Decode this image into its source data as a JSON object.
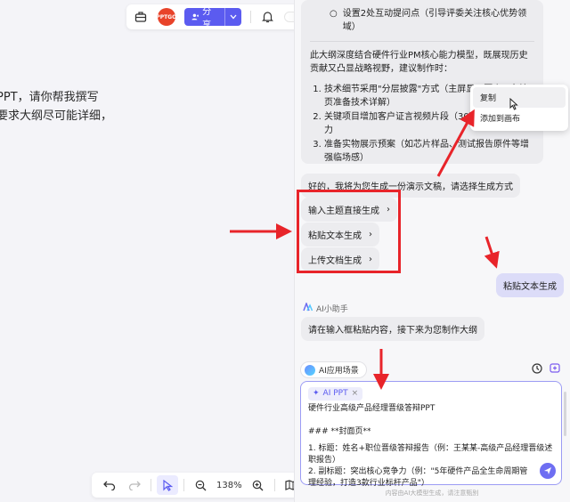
{
  "canvas": {
    "lines": [
      "PPT，请你帮我撰写",
      "要求大纲尽可能详细，"
    ]
  },
  "top_toolbar": {
    "avatar_text": "PPTGO",
    "share_label": "分享"
  },
  "bottom_toolbar": {
    "zoom": "138%"
  },
  "ai_message": {
    "sub_bullet": "设置2处互动提问点（引导评委关注核心优势领域）",
    "summary": "此大纲深度结合硬件行业PM核心能力模型，既展现历史贡献又凸显战略视野，建议制作时：",
    "items": [
      "技术细节采用\"分层披露\"方式（主屏显示要点，备注页准备技术详解）",
      "关键项目增加客户证言视频片段（30秒内）提升说服力",
      "准备实物展示预案（如芯片样品、测试报告原件等增强临场感）"
    ]
  },
  "context_menu": {
    "items": [
      "复制",
      "添加到画布"
    ]
  },
  "chat": {
    "prompt": "好的，我将为您生成一份演示文稿，请选择生成方式",
    "options": [
      "输入主题直接生成",
      "粘贴文本生成",
      "上传文档生成"
    ],
    "user_reply": "粘贴文本生成",
    "assistant_name": "AI小助手",
    "assistant_reply": "请在输入框粘贴内容，接下来为您制作大纲"
  },
  "composer": {
    "scene_label": "AI应用场景",
    "chip_label": "AI PPT",
    "lines": [
      "硬件行业高级产品经理晋级答辩PPT",
      "",
      "### **封面页**",
      "1. 标题：姓名+职位晋级答辩报告（例：王某某-高级产品经理晋级述职报告）",
      "2. 副标题：突出核心竞争力（例：\"5年硬件产品全生命周期管理经验，打造3款行业标杆产品\"）"
    ],
    "footer_note": "内容由AI大模型生成，请注意甄别"
  },
  "colors": {
    "accent": "#5b5bf0",
    "annotation_red": "#e8242a"
  }
}
